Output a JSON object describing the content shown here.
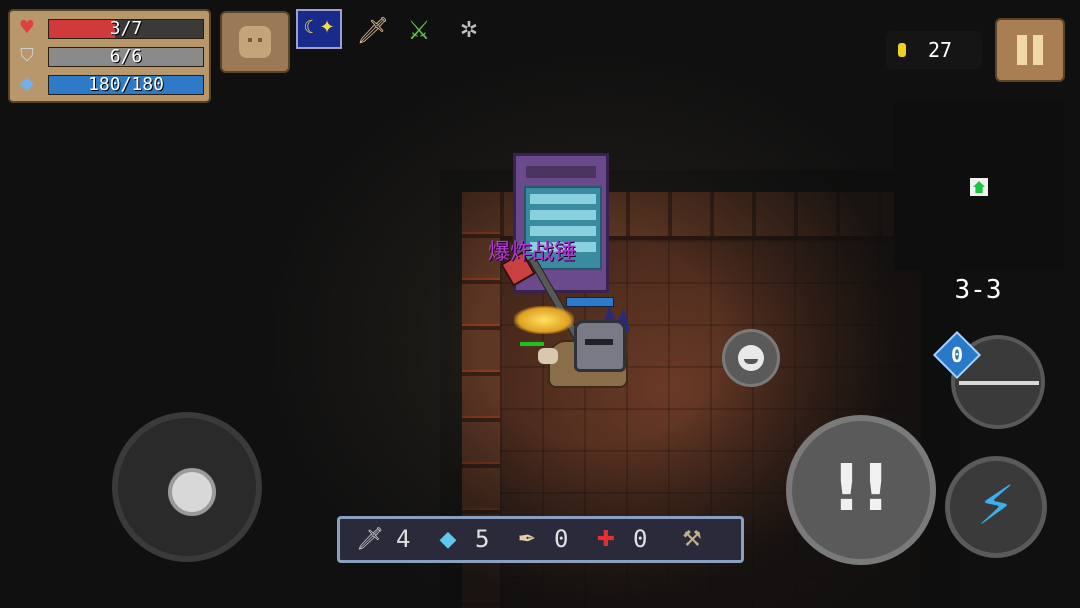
{
  "hud": {
    "health": {
      "label": "3/7",
      "current": 3,
      "max": 7,
      "color": "#d03a3a",
      "icon": "heart-icon"
    },
    "armor": {
      "label": "6/6",
      "current": 6,
      "max": 6,
      "color": "#8a8a8a",
      "icon": "shield-icon"
    },
    "energy": {
      "label": "180/180",
      "current": 180,
      "max": 180,
      "color": "#2f7ac8",
      "icon": "diamond-icon"
    },
    "buffs": [
      "night-buff-icon",
      "sword-fist-buff-icon",
      "green-swords-buff-icon",
      "spider-buff-icon"
    ],
    "coins": "27",
    "level": "3-3"
  },
  "world": {
    "item_label": "爆炸战锤",
    "item_label_color": "#b03ad0"
  },
  "weapon_switch": {
    "energy_cost": "0",
    "icon": "arrow-icon"
  },
  "inventory": {
    "slots": [
      {
        "icon": "sword-icon",
        "value": "4"
      },
      {
        "icon": "diamond-icon",
        "value": "5"
      },
      {
        "icon": "feather-icon",
        "value": "0"
      },
      {
        "icon": "medkit-icon",
        "value": "0"
      },
      {
        "icon": "axe-icon",
        "value": ""
      }
    ]
  },
  "colors": {
    "panel": "#b8986a",
    "accent_blue": "#3ab0f0"
  }
}
